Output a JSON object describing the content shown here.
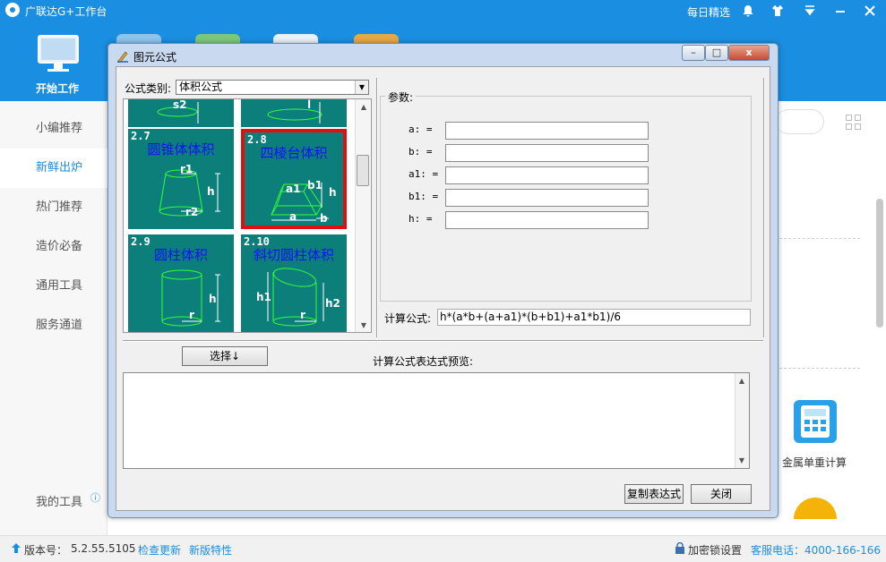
{
  "app": {
    "title": "广联达G+工作台",
    "header_links": [
      "每日精选"
    ],
    "nav_start_label": "开始工作"
  },
  "sidebar": {
    "items": [
      {
        "label": "小编推荐"
      },
      {
        "label": "新鲜出炉"
      },
      {
        "label": "热门推荐"
      },
      {
        "label": "造价必备"
      },
      {
        "label": "通用工具"
      },
      {
        "label": "服务通道"
      }
    ],
    "my_tools": "我的工具"
  },
  "right_panel": {
    "tool_label": "金属单重计算"
  },
  "status_bar": {
    "version_label": "版本号：",
    "version": "5.2.55.5105",
    "check_update": "检查更新",
    "new_features": "新版特性",
    "lock_settings": "加密锁设置",
    "service_phone": "客服电话：4000-166-166"
  },
  "dialog": {
    "title": "图元公式",
    "window_buttons": [
      "–",
      "□",
      "x"
    ],
    "category_label": "公式类别:",
    "category_value": "体积公式",
    "tiles": [
      {
        "num": "",
        "title": "",
        "labels": [
          "s2"
        ]
      },
      {
        "num": "",
        "title": "",
        "labels": [
          "l"
        ]
      },
      {
        "num": "2.7",
        "title": "圆锥体体积",
        "labels": [
          "r1",
          "h",
          "r2"
        ]
      },
      {
        "num": "2.8",
        "title": "四棱台体积",
        "labels": [
          "a1",
          "b1",
          "h",
          "a",
          "b"
        ]
      },
      {
        "num": "2.9",
        "title": "圆柱体积",
        "labels": [
          "h",
          "r"
        ]
      },
      {
        "num": "2.10",
        "title": "斜切圆柱体积",
        "labels": [
          "h1",
          "r",
          "h2"
        ]
      }
    ],
    "params_title": "参数:",
    "params": [
      {
        "label": "a:  =",
        "value": ""
      },
      {
        "label": "b:  =",
        "value": ""
      },
      {
        "label": "a1: =",
        "value": ""
      },
      {
        "label": "b1: =",
        "value": ""
      },
      {
        "label": "h:  =",
        "value": ""
      }
    ],
    "formula_label": "计算公式:",
    "formula_value": "h*(a*b+(a+a1)*(b+b1)+a1*b1)/6",
    "select_button": "选择↓",
    "preview_label": "计算公式表达式预览:",
    "copy_button": "复制表达式",
    "close_button": "关闭"
  },
  "colors": {
    "header_blue": "#1a8ee0",
    "tile_teal": "#0c7f7b",
    "tile_title": "#1010ff",
    "selected_border": "#e01010",
    "diagram_line": "#33ff33"
  }
}
